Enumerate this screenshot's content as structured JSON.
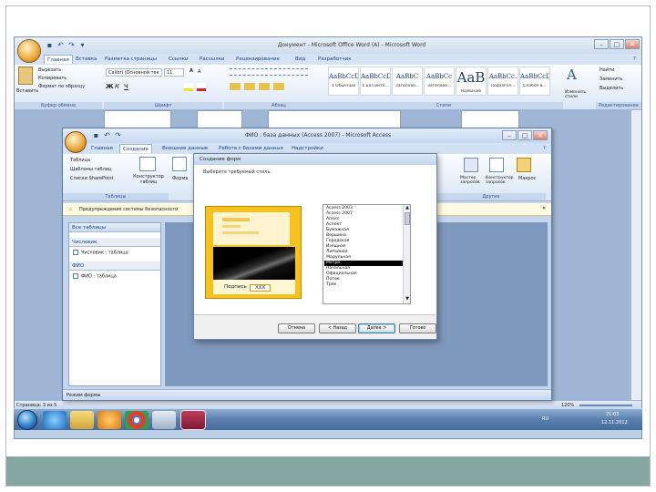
{
  "word": {
    "title": "Документ - Microsoft Office Word (А) - Microsoft Word",
    "tabs": [
      "Главная",
      "Вставка",
      "Разметка страницы",
      "Ссылки",
      "Рассылки",
      "Рецензирование",
      "Вид",
      "Разработчик"
    ],
    "clipboard": {
      "paste": "Вставить",
      "cut": "Вырезать",
      "copy": "Копировать",
      "format_painter": "Формат по образцу",
      "group": "Буфер обмена"
    },
    "font": {
      "name": "Calibri (Основной тек",
      "size": "11",
      "group": "Шрифт"
    },
    "paragraph_group": "Абзац",
    "styles": [
      {
        "sample": "AaBbCcDc",
        "name": "1 Обычный"
      },
      {
        "sample": "AaBbCcDc",
        "name": "1 Без инте..."
      },
      {
        "sample": "AaBbC",
        "name": "Заголово..."
      },
      {
        "sample": "AaBbCc",
        "name": "Заголово..."
      },
      {
        "sample": "AaB",
        "name": "Название"
      },
      {
        "sample": "AaBbCc.",
        "name": "Подзагол..."
      },
      {
        "sample": "AaBbCcDc",
        "name": "Слабое в..."
      }
    ],
    "styles_group": "Стили",
    "change_styles": "Изменить стили",
    "editing": {
      "find": "Найти",
      "replace": "Заменить",
      "select": "Выделить",
      "group": "Редактирование"
    },
    "status": {
      "page": "Страница: 3 из 5",
      "zoom": "120%"
    }
  },
  "taskbar": {
    "icons": [
      "windows-start",
      "internet-explorer",
      "explorer",
      "media-player",
      "chrome",
      "notepad",
      "access"
    ],
    "lang": "RU",
    "time": "21:03",
    "date": "12.11.2012"
  },
  "access": {
    "title": "ФИО : база данных (Access 2007) - Microsoft Access",
    "tabs": [
      "Главная",
      "Создание",
      "Внешние данные",
      "Работа с базами данных",
      "Надстройки"
    ],
    "active_tab": "Создание",
    "ribbon": {
      "tables_items": [
        "Таблица",
        "Шаблоны таблиц",
        "Списки SharePoint"
      ],
      "table_designer": "Конструктор таблиц",
      "tables_group": "Таблицы",
      "forms_label": "Форма",
      "query_items": [
        "Мастер запросов",
        "Конструктор запросов",
        "Макрос"
      ],
      "other_group": "Другие"
    },
    "security_warning": "Предупреждение системы безопасности",
    "nav": {
      "header": "Все таблицы",
      "groups": [
        {
          "name": "Числовик",
          "items": [
            "Числовик : таблица"
          ]
        },
        {
          "name": "ФИО",
          "items": [
            "ФИО : таблица"
          ]
        }
      ]
    },
    "status": "Режим формы"
  },
  "dialog": {
    "title": "Создание форм",
    "prompt": "Выберите требуемый стиль.",
    "preview_caption": "Подпись",
    "preview_value": "XXX",
    "styles": [
      "Access 2003",
      "Access 2007",
      "Апекс",
      "Аспект",
      "Бумажная",
      "Вершина",
      "Городская",
      "Изящная",
      "Литейная",
      "Модульная",
      "Метро",
      "Начальная",
      "Официальная",
      "Поток",
      "Трек"
    ],
    "selected_style": "Метро",
    "buttons": {
      "cancel": "Отмена",
      "back": "< Назад",
      "next": "Далее >",
      "finish": "Готово"
    }
  }
}
